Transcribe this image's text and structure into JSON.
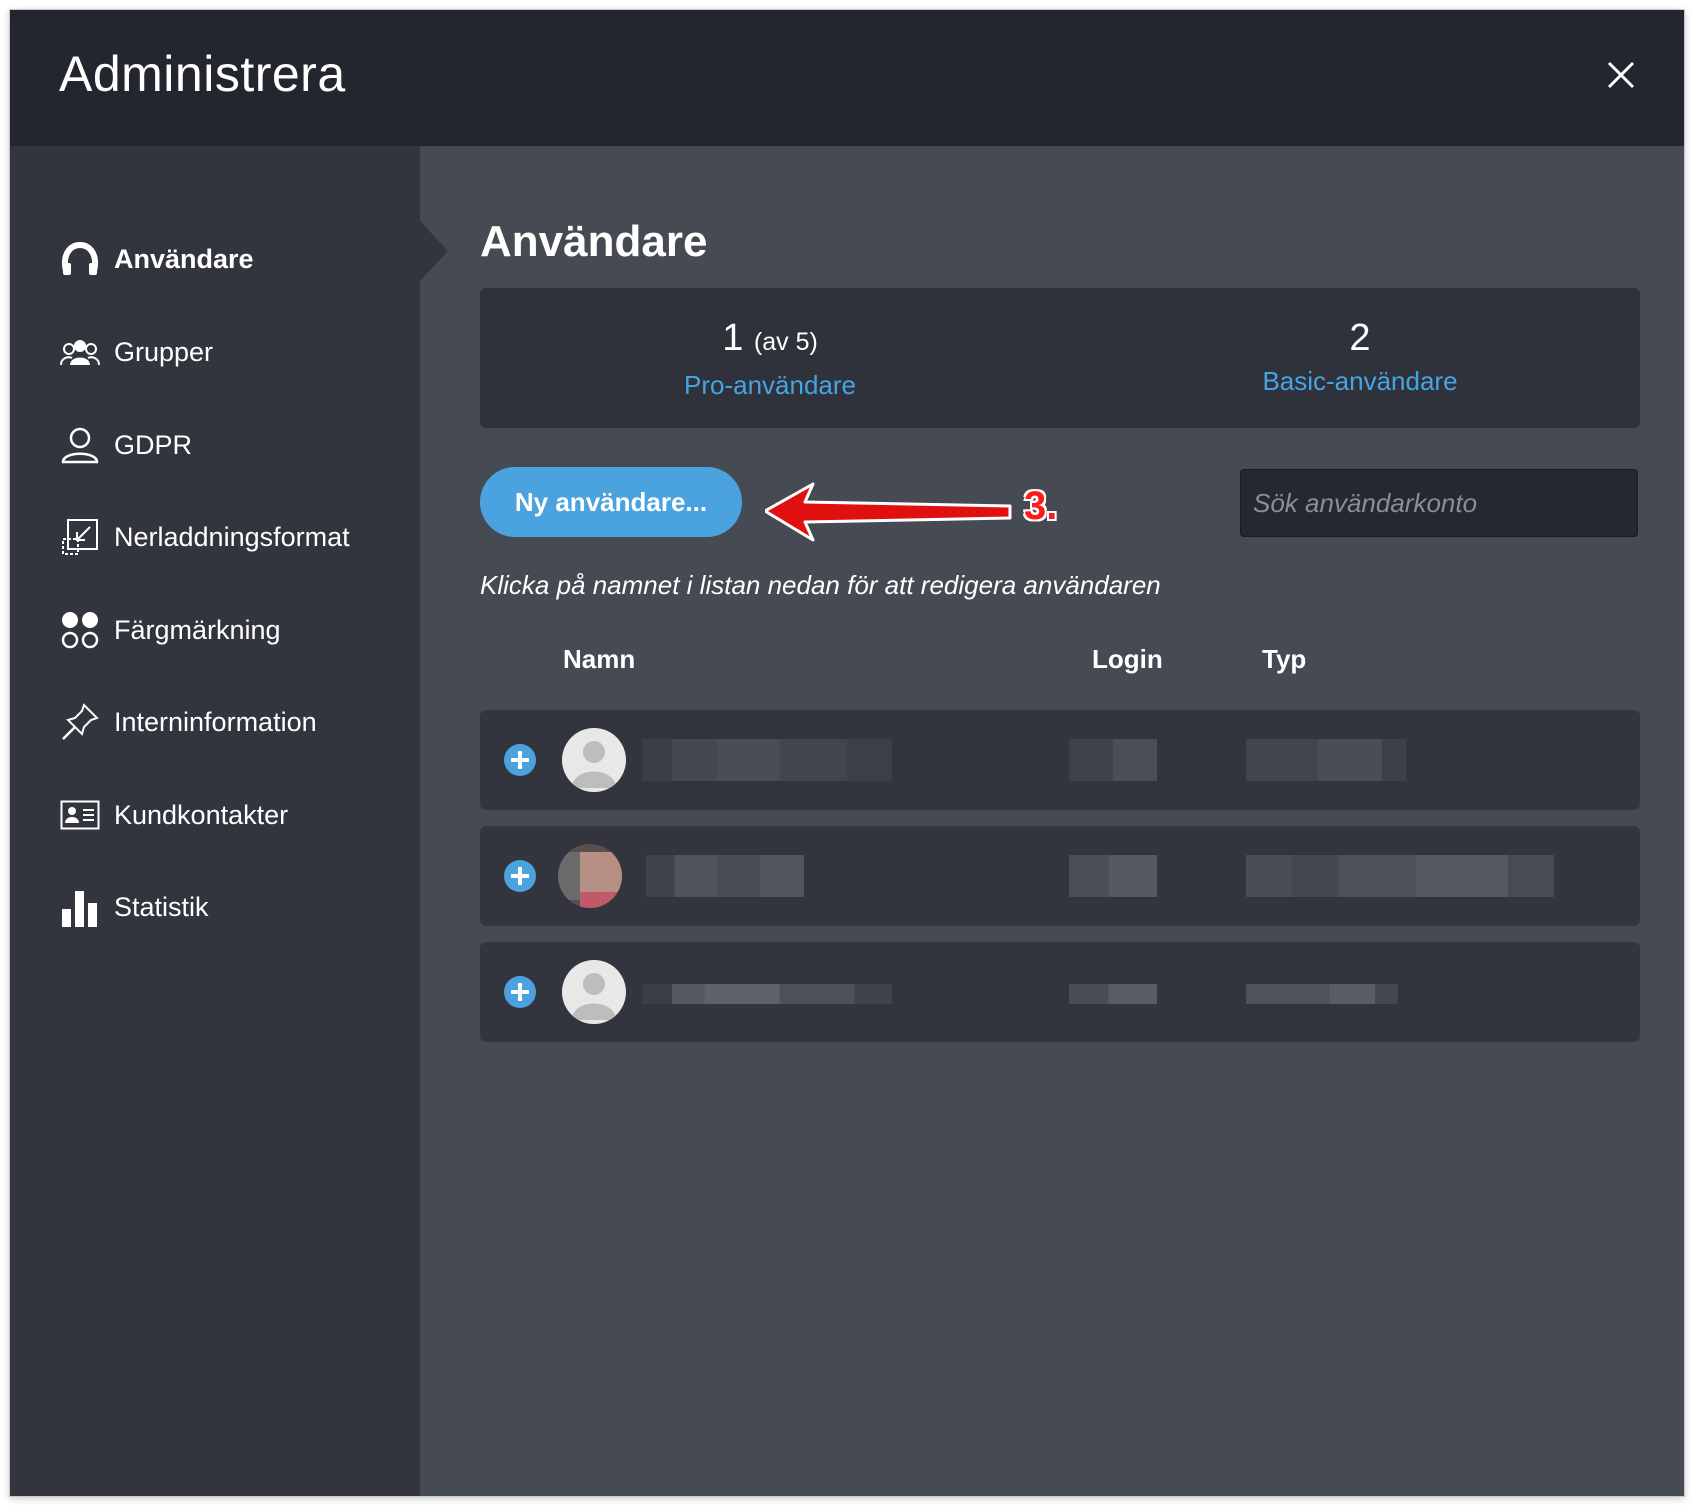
{
  "window": {
    "title": "Administrera"
  },
  "sidebar": {
    "items": [
      {
        "label": "Användare",
        "icon": "headset-user-icon",
        "active": true
      },
      {
        "label": "Grupper",
        "icon": "group-icon"
      },
      {
        "label": "GDPR",
        "icon": "person-outline-icon"
      },
      {
        "label": "Nerladdningsformat",
        "icon": "resize-icon"
      },
      {
        "label": "Färgmärkning",
        "icon": "color-dots-icon"
      },
      {
        "label": "Interninformation",
        "icon": "pin-icon"
      },
      {
        "label": "Kundkontakter",
        "icon": "contact-card-icon"
      },
      {
        "label": "Statistik",
        "icon": "bar-chart-icon"
      }
    ]
  },
  "main": {
    "title": "Användare",
    "stats": {
      "pro": {
        "count": "1",
        "of": "(av 5)",
        "label": "Pro-användare"
      },
      "basic": {
        "count": "2",
        "label": "Basic-användare"
      }
    },
    "new_user_button": "Ny användare...",
    "search_placeholder": "Sök användarkonto",
    "hint": "Klicka på namnet i listan nedan för att redigera användaren",
    "columns": {
      "name": "Namn",
      "login": "Login",
      "type": "Typ"
    },
    "annotation_step": "3.",
    "colors": {
      "accent": "#4aa3df",
      "header": "#23262e",
      "sidebar": "#32353d",
      "content": "#464a52",
      "annotation": "#e01010"
    }
  }
}
